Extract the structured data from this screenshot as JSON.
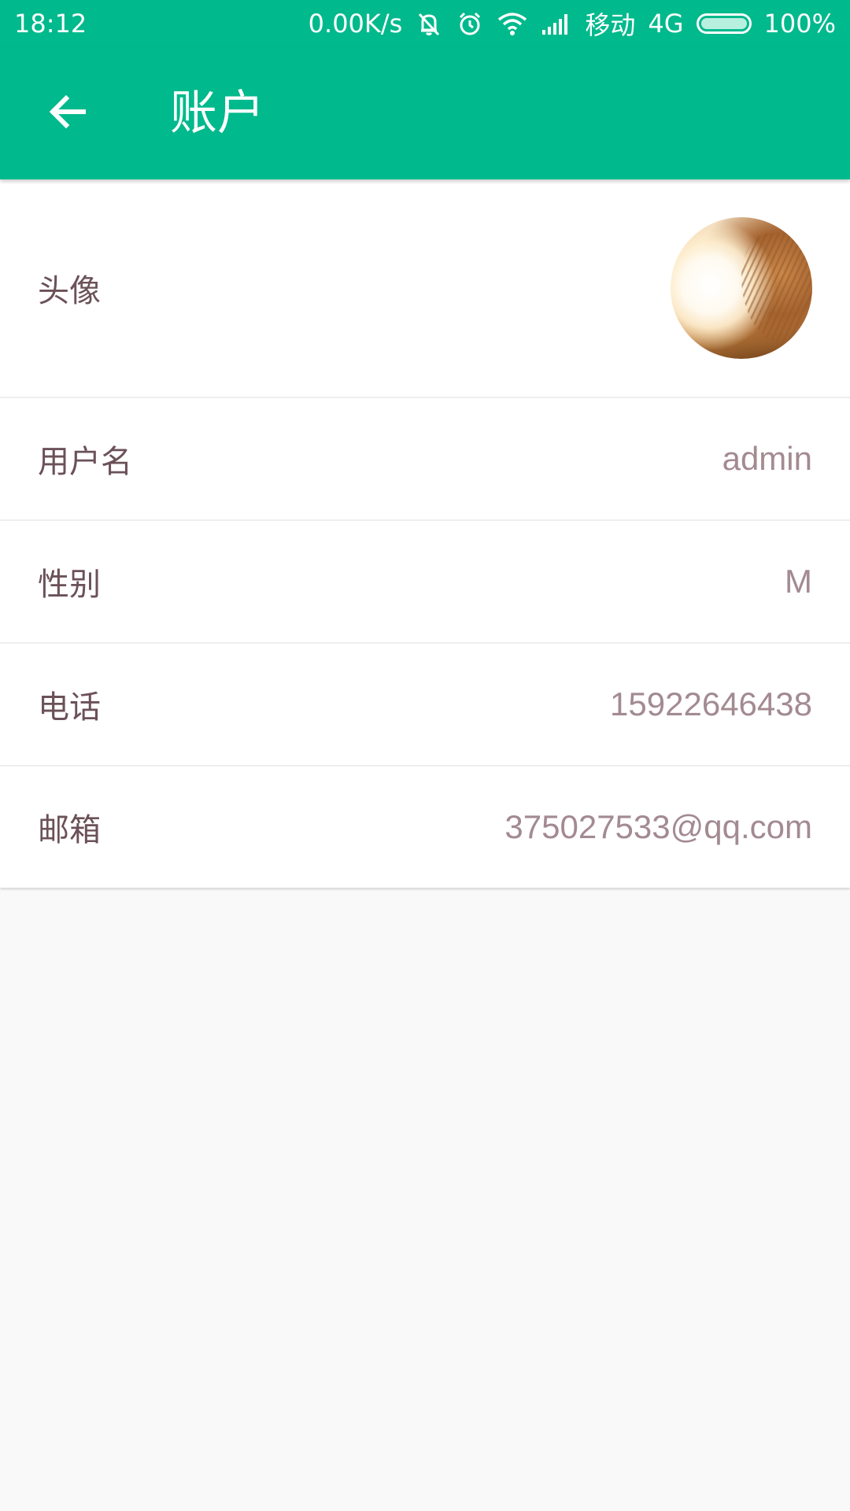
{
  "status_bar": {
    "time": "18:12",
    "net_speed": "0.00K/s",
    "carrier": "移动",
    "network": "4G",
    "battery": "100%",
    "battery_level": 1.0
  },
  "app_bar": {
    "title": "账户",
    "back_icon": "arrow-left-icon",
    "color": "#00b98c"
  },
  "account": {
    "avatar_label": "头像",
    "rows": [
      {
        "label": "用户名",
        "value": "admin"
      },
      {
        "label": "性别",
        "value": "M"
      },
      {
        "label": "电话",
        "value": "15922646438"
      },
      {
        "label": "邮箱",
        "value": "375027533@qq.com"
      }
    ]
  }
}
